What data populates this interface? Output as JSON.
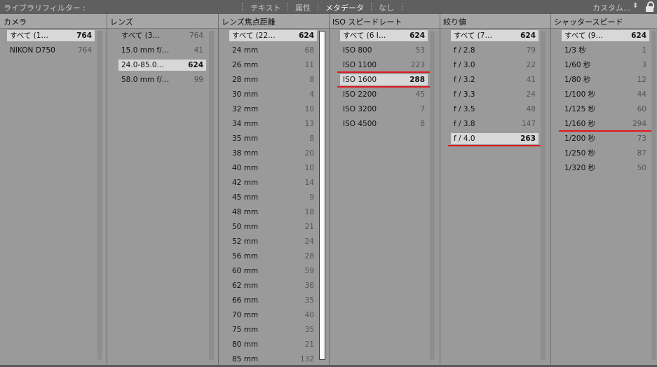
{
  "topbar": {
    "title": "ライブラリフィルター :",
    "tabs": [
      "テキスト",
      "属性",
      "メタデータ",
      "なし"
    ],
    "preset": "カスタム...",
    "chevron": "⬍"
  },
  "columns": [
    {
      "header": "カメラ",
      "rows": [
        {
          "label": "すべて (1…",
          "count": "764",
          "selected": true
        },
        {
          "label": "NIKON D750",
          "count": "764"
        }
      ]
    },
    {
      "header": "レンズ",
      "rows": [
        {
          "label": "すべて (3…",
          "count": "764"
        },
        {
          "label": "15.0 mm f/…",
          "count": "41"
        },
        {
          "label": "24.0-85.0…",
          "count": "624",
          "selected": true
        },
        {
          "label": "58.0 mm f/…",
          "count": "99"
        }
      ]
    },
    {
      "header": "レンズ焦点距離",
      "rows": [
        {
          "label": "すべて (22…",
          "count": "624",
          "selected": true
        },
        {
          "label": "24 mm",
          "count": "68"
        },
        {
          "label": "26 mm",
          "count": "11"
        },
        {
          "label": "28 mm",
          "count": "8"
        },
        {
          "label": "30 mm",
          "count": "4"
        },
        {
          "label": "32 mm",
          "count": "10"
        },
        {
          "label": "34 mm",
          "count": "13"
        },
        {
          "label": "35 mm",
          "count": "8"
        },
        {
          "label": "38 mm",
          "count": "20"
        },
        {
          "label": "40 mm",
          "count": "10"
        },
        {
          "label": "42 mm",
          "count": "14"
        },
        {
          "label": "45 mm",
          "count": "9"
        },
        {
          "label": "48 mm",
          "count": "18"
        },
        {
          "label": "50 mm",
          "count": "21"
        },
        {
          "label": "52 mm",
          "count": "24"
        },
        {
          "label": "56 mm",
          "count": "28"
        },
        {
          "label": "60 mm",
          "count": "59"
        },
        {
          "label": "62 mm",
          "count": "36"
        },
        {
          "label": "66 mm",
          "count": "35"
        },
        {
          "label": "70 mm",
          "count": "40"
        },
        {
          "label": "75 mm",
          "count": "35"
        },
        {
          "label": "80 mm",
          "count": "21"
        },
        {
          "label": "85 mm",
          "count": "132"
        }
      ]
    },
    {
      "header": "ISO スピードレート",
      "rows": [
        {
          "label": "すべて (6 I…",
          "count": "624",
          "selected": true
        },
        {
          "label": "ISO 800",
          "count": "53"
        },
        {
          "label": "ISO 1100",
          "count": "223",
          "marked": true
        },
        {
          "label": "ISO 1600",
          "count": "288",
          "selected": true,
          "marked": true
        },
        {
          "label": "ISO 2200",
          "count": "45"
        },
        {
          "label": "ISO 3200",
          "count": "7"
        },
        {
          "label": "ISO 4500",
          "count": "8"
        }
      ]
    },
    {
      "header": "絞り値",
      "rows": [
        {
          "label": "すべて (7…",
          "count": "624",
          "selected": true
        },
        {
          "label": "f / 2.8",
          "count": "79"
        },
        {
          "label": "f / 3.0",
          "count": "22"
        },
        {
          "label": "f / 3.2",
          "count": "41"
        },
        {
          "label": "f / 3.3",
          "count": "24"
        },
        {
          "label": "f / 3.5",
          "count": "48"
        },
        {
          "label": "f / 3.8",
          "count": "147"
        },
        {
          "label": "f / 4.0",
          "count": "263",
          "selected": true,
          "marked": true
        }
      ]
    },
    {
      "header": "シャッタースピード",
      "rows": [
        {
          "label": "すべて (9…",
          "count": "624",
          "selected": true
        },
        {
          "label": "1/3 秒",
          "count": "1"
        },
        {
          "label": "1/60 秒",
          "count": "3"
        },
        {
          "label": "1/80 秒",
          "count": "12"
        },
        {
          "label": "1/100 秒",
          "count": "44"
        },
        {
          "label": "1/125 秒",
          "count": "60"
        },
        {
          "label": "1/160 秒",
          "count": "294",
          "marked": true
        },
        {
          "label": "1/200 秒",
          "count": "73"
        },
        {
          "label": "1/250 秒",
          "count": "87"
        },
        {
          "label": "1/320 秒",
          "count": "50"
        }
      ]
    }
  ],
  "colors": {
    "annotation_line": "#e0181e",
    "selected_row": "#d8d8d8",
    "panel": "#9a9a9a"
  }
}
